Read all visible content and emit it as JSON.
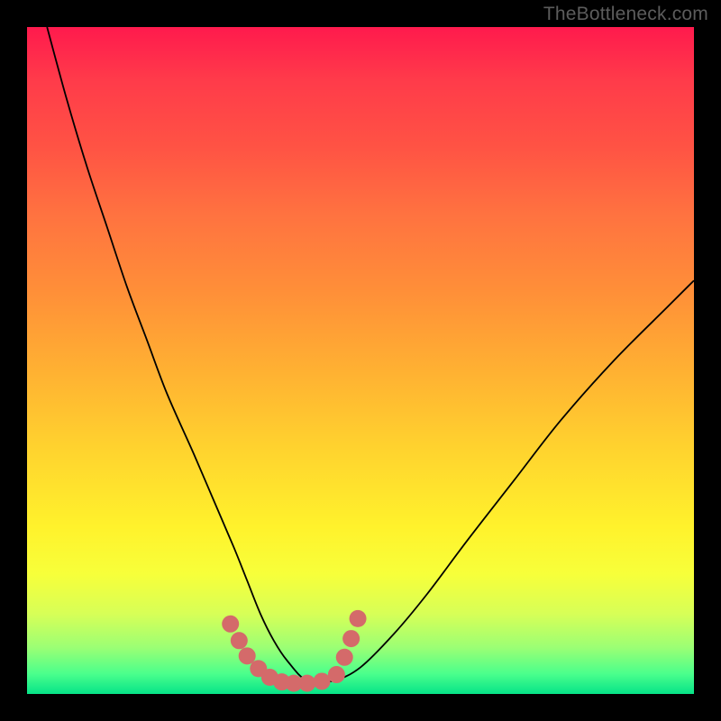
{
  "watermark": "TheBottleneck.com",
  "chart_data": {
    "type": "line",
    "title": "",
    "xlabel": "",
    "ylabel": "",
    "xlim": [
      0,
      100
    ],
    "ylim": [
      0,
      100
    ],
    "gradient_stops": [
      {
        "pos": 0,
        "color": "#ff1a4d"
      },
      {
        "pos": 50,
        "color": "#ffb232"
      },
      {
        "pos": 80,
        "color": "#fff22c"
      },
      {
        "pos": 100,
        "color": "#06e388"
      }
    ],
    "series": [
      {
        "name": "bottleneck-curve",
        "color": "#000000",
        "x": [
          3,
          6,
          9,
          12,
          15,
          18,
          21,
          25,
          28,
          31,
          33,
          35,
          37,
          39,
          42,
          46,
          50,
          55,
          60,
          66,
          73,
          80,
          88,
          96,
          100
        ],
        "y": [
          100,
          89,
          79,
          70,
          61,
          53,
          45,
          36,
          29,
          22,
          17,
          12,
          8,
          5,
          2,
          2,
          4,
          9,
          15,
          23,
          32,
          41,
          50,
          58,
          62
        ]
      },
      {
        "name": "highlight-dots",
        "color": "#d46a6a",
        "type": "scatter",
        "x": [
          30.5,
          31.8,
          33.0,
          34.7,
          36.4,
          38.2,
          40.0,
          42.0,
          44.2,
          46.4,
          47.6,
          48.6,
          49.6
        ],
        "y": [
          10.5,
          8.0,
          5.7,
          3.8,
          2.5,
          1.8,
          1.6,
          1.6,
          1.9,
          2.9,
          5.5,
          8.3,
          11.3
        ]
      }
    ]
  }
}
